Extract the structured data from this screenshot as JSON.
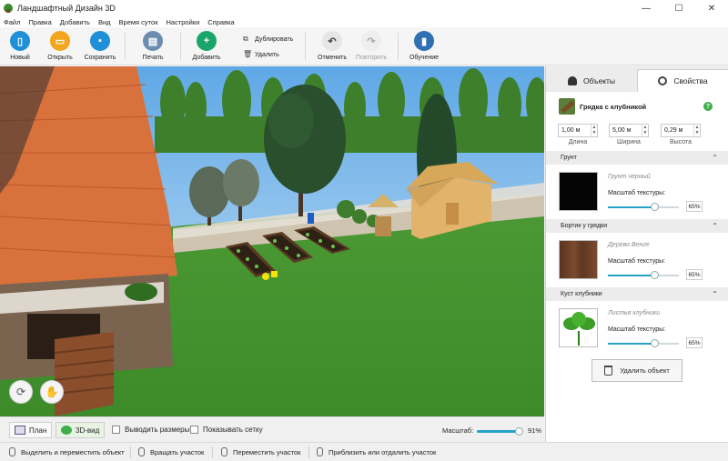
{
  "window": {
    "title": "Ландшафтный Дизайн 3D",
    "controls": [
      "—",
      "☐",
      "✕"
    ]
  },
  "menu": [
    "Файл",
    "Правка",
    "Добавить",
    "Вид",
    "Время суток",
    "Настройки",
    "Справка"
  ],
  "toolbar": {
    "new": "Новый",
    "open": "Открыть",
    "save": "Сохранить",
    "print": "Печать",
    "add": "Добавить",
    "duplicate": "Дублировать",
    "delete": "Удалить",
    "undo": "Отменить",
    "redo": "Повторить",
    "learn": "Обучение",
    "colors": {
      "new": "#1f8fd8",
      "open": "#f2a51e",
      "save": "#1f8fd8",
      "print": "#6d8db0",
      "add": "#1aa66a",
      "learn": "#2f6fb2"
    }
  },
  "viewbar": {
    "plan": "План",
    "view3d": "3D-вид",
    "show_sizes": "Выводить размеры",
    "show_grid": "Показывать сетку",
    "zoom_label": "Масштаб:",
    "zoom_value": "91%",
    "zoom_fraction": 0.91
  },
  "status": [
    "Выделить и переместить объект",
    "Вращать участок",
    "Переместить участок",
    "Приблизить или отдалить участок"
  ],
  "panel": {
    "tab_objects": "Объекты",
    "tab_properties": "Свойства",
    "object_name": "Грядка с клубникой",
    "help": "?",
    "length": "1,00 м",
    "width": "5,00 м",
    "height": "0,29 м",
    "length_label": "Длина",
    "width_label": "Ширина",
    "height_label": "Высота",
    "sections": [
      {
        "title": "Грунт",
        "material": "Грунт черный",
        "texture_label": "Масштаб текстуры:",
        "texture_value": "65%",
        "fraction": 0.65,
        "swatch": "#050505"
      },
      {
        "title": "Бортик у грядки",
        "material": "Дерево Венге",
        "texture_label": "Масштаб текстуры:",
        "texture_value": "65%",
        "fraction": 0.65,
        "swatch": "#6b3f27"
      },
      {
        "title": "Куст клубники",
        "material": "Листья клубники",
        "texture_label": "Масштаб текстуры:",
        "texture_value": "65%",
        "fraction": 0.65,
        "swatch": "#ffffff"
      }
    ],
    "delete": "Удалить объект"
  }
}
